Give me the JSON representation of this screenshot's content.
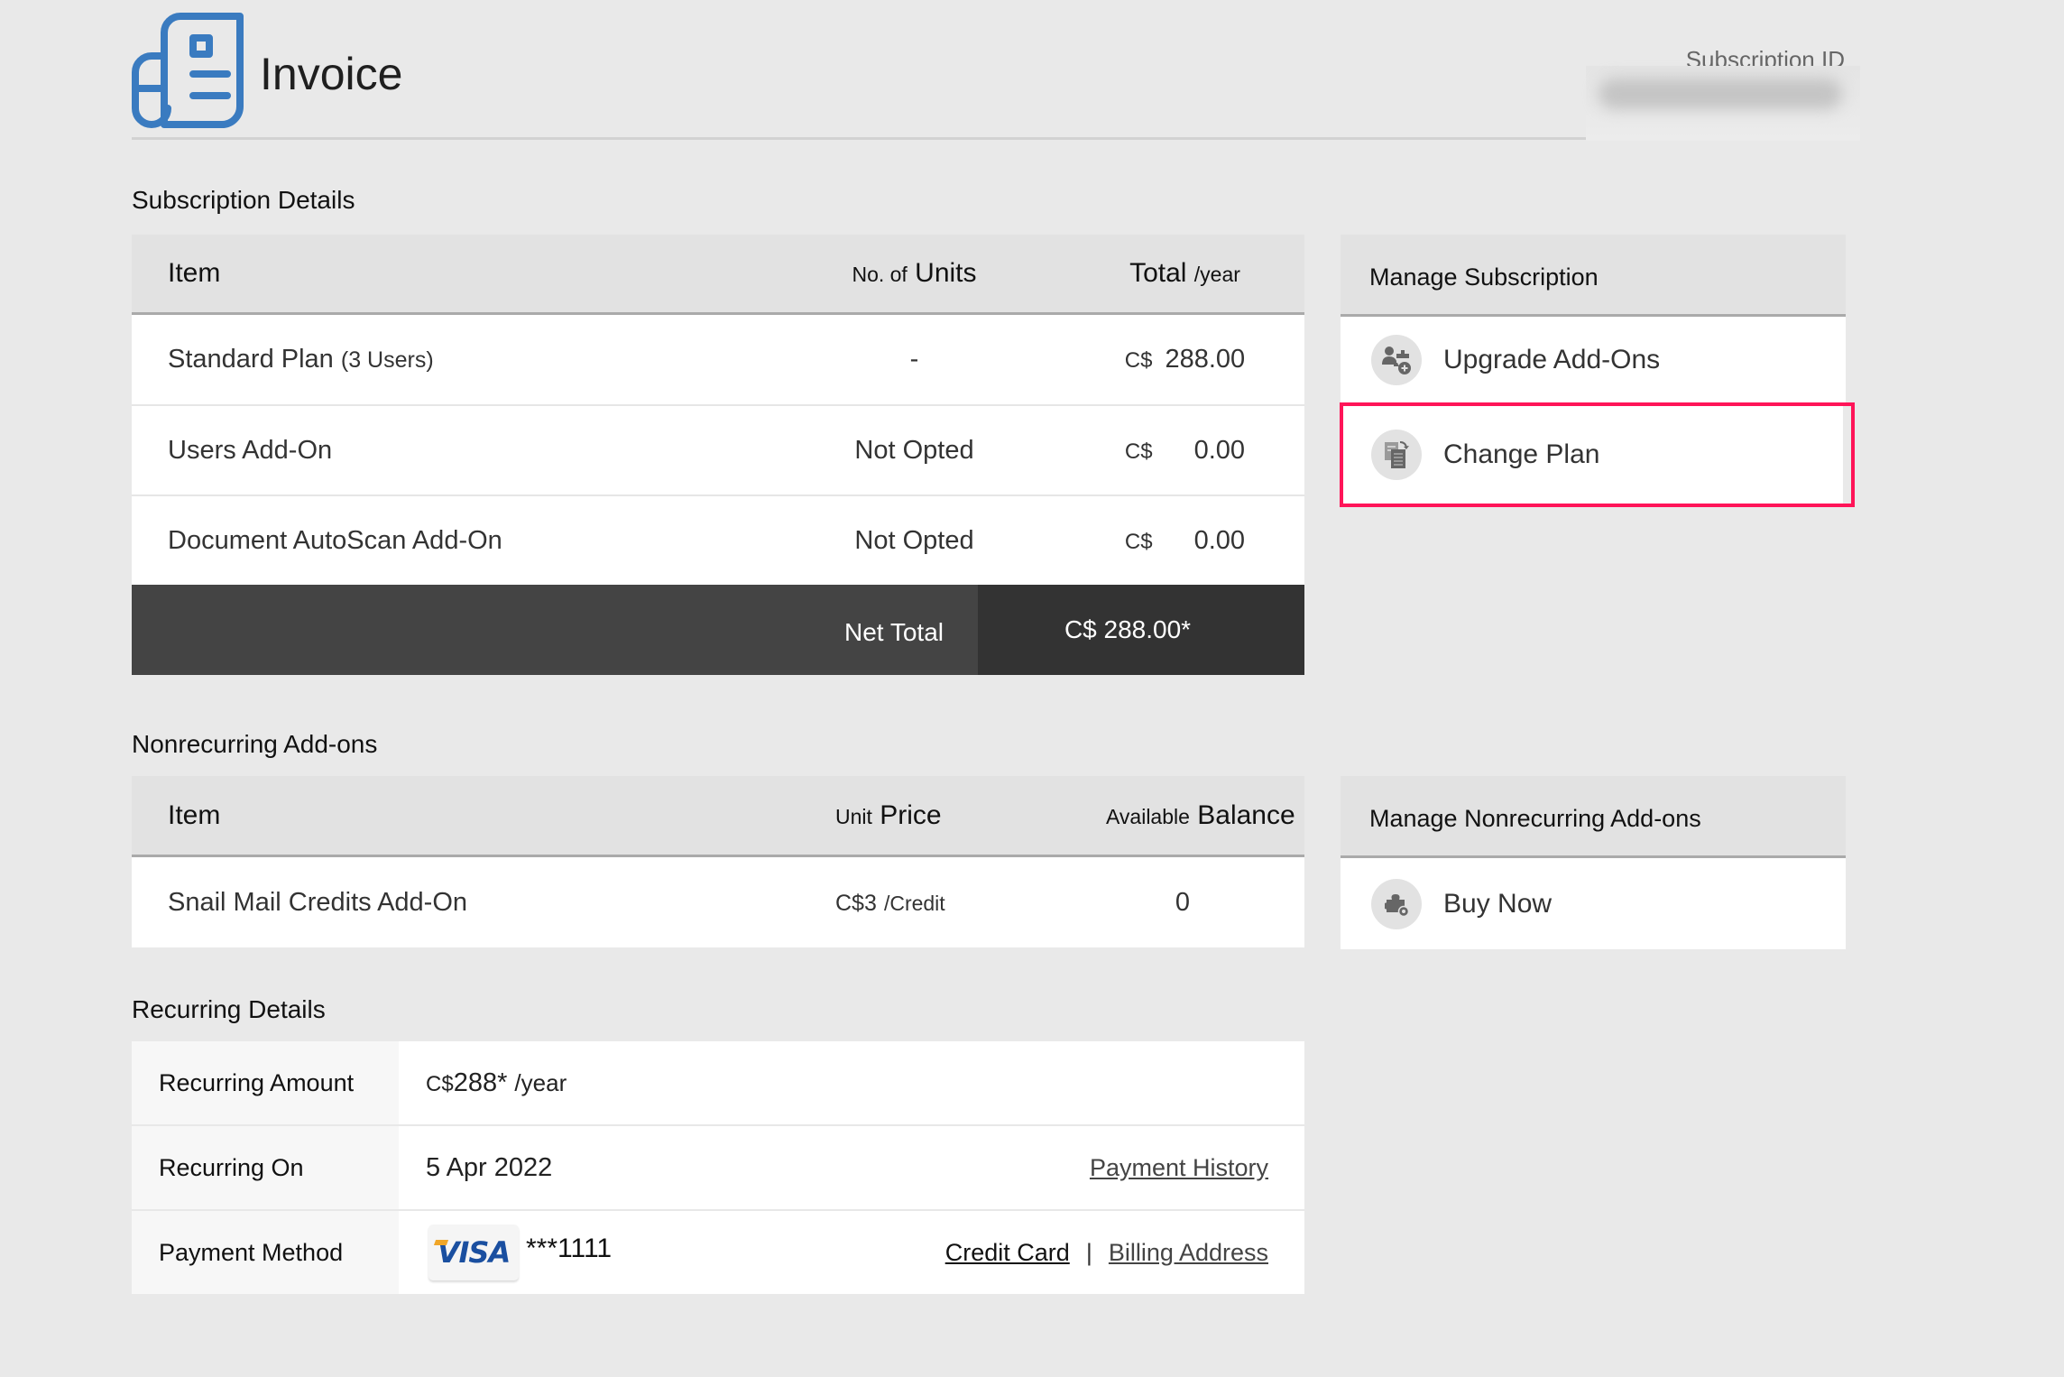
{
  "header": {
    "title": "Invoice",
    "subscription_id_label": "Subscription ID",
    "subscription_id_value": "[redacted]"
  },
  "subscription": {
    "section_label": "Subscription Details",
    "columns": {
      "item": "Item",
      "units_prefix": "No. of",
      "units_main": "Units",
      "total_main": "Total",
      "total_suffix": "/year"
    },
    "rows": [
      {
        "item": "Standard Plan",
        "item_note": "(3 Users)",
        "units": "-",
        "currency": "C$",
        "amount": "288.00"
      },
      {
        "item": "Users Add-On",
        "item_note": "",
        "units": "Not Opted",
        "currency": "C$",
        "amount": "0.00"
      },
      {
        "item": "Document AutoScan Add-On",
        "item_note": "",
        "units": "Not Opted",
        "currency": "C$",
        "amount": "0.00"
      }
    ],
    "net_total_label": "Net Total",
    "net_total_value": "C$ 288.00*"
  },
  "manage_subscription": {
    "title": "Manage Subscription",
    "items": [
      {
        "label": "Upgrade Add-Ons",
        "icon": "user-addon-icon"
      },
      {
        "label": "Change Plan",
        "icon": "change-plan-icon",
        "highlighted": true
      }
    ]
  },
  "nonrecurring": {
    "section_label": "Nonrecurring Add-ons",
    "columns": {
      "item": "Item",
      "price_prefix": "Unit",
      "price_main": "Price",
      "balance_prefix": "Available",
      "balance_main": "Balance"
    },
    "rows": [
      {
        "item": "Snail Mail Credits Add-On",
        "price": "C$3",
        "price_unit": "/Credit",
        "balance": "0"
      }
    ]
  },
  "manage_nonrecurring": {
    "title": "Manage Nonrecurring Add-ons",
    "items": [
      {
        "label": "Buy Now",
        "icon": "puzzle-addon-icon"
      }
    ]
  },
  "recurring": {
    "section_label": "Recurring Details",
    "amount_label": "Recurring Amount",
    "amount_currency": "C$",
    "amount_value": "288*",
    "amount_period": "/year",
    "on_label": "Recurring On",
    "on_value": "5 Apr 2022",
    "payment_history_link": "Payment History",
    "method_label": "Payment Method",
    "card_brand": "VISA",
    "card_masked": "***1111",
    "credit_card_link": "Credit Card",
    "link_separator": "|",
    "billing_address_link": "Billing Address"
  },
  "colors": {
    "background": "#e9e9e9",
    "brand_icon": "#3a7bc0",
    "highlight": "#ff1458",
    "net_total_left": "#444444",
    "net_total_right": "#333333"
  }
}
